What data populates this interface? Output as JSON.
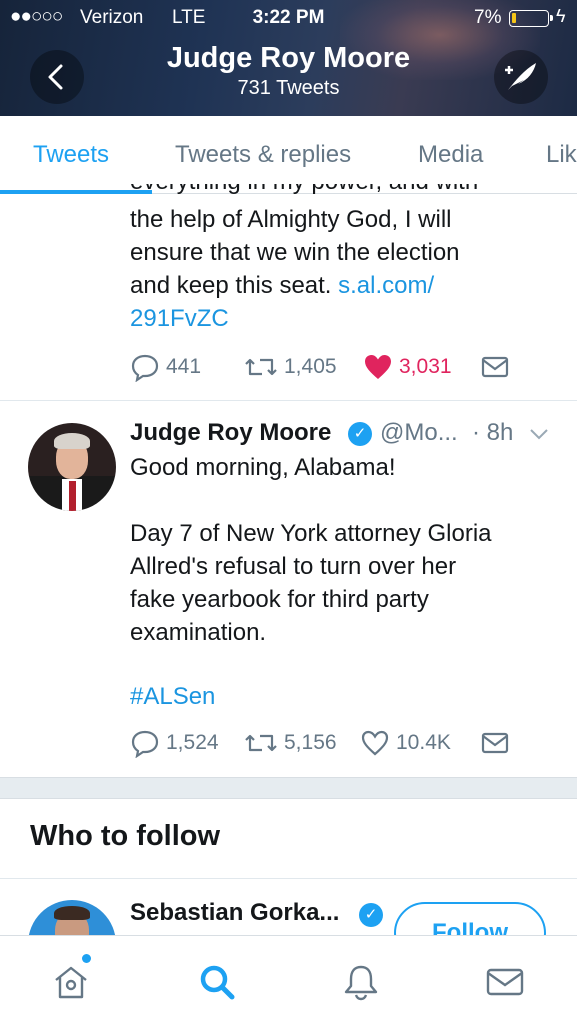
{
  "status_bar": {
    "signal": "●●○○○",
    "carrier": "Verizon",
    "network": "LTE",
    "time": "3:22 PM",
    "battery_pct": "7%",
    "battery_level": 0.07,
    "battery_color": "#f5c518"
  },
  "header": {
    "back_icon": "chevron-left-icon",
    "title": "Judge Roy Moore",
    "subtitle": "731 Tweets",
    "compose_icon": "compose-feather-icon"
  },
  "tabs": [
    {
      "label": "Tweets",
      "active": true
    },
    {
      "label": "Tweets & replies",
      "active": false
    },
    {
      "label": "Media",
      "active": false
    },
    {
      "label": "Lik",
      "active": false
    }
  ],
  "tweets": [
    {
      "clipped_line": "everything in my power, and with",
      "lines": [
        "the help of Almighty God, I will",
        "ensure that we win the election"
      ],
      "last_line_text": "and keep this seat.",
      "link_part1": "s.al.com/",
      "link_part2": "291FvZC",
      "replies": "441",
      "retweets": "1,405",
      "likes": "3,031",
      "liked": true
    },
    {
      "name": "Judge Roy Moore",
      "handle": "@Mo...",
      "time": "· 8h",
      "verified": true,
      "line1": "Good morning, Alabama!",
      "para_lines": [
        "Day 7 of New York attorney Gloria",
        "Allred's refusal to turn over her",
        "fake yearbook for third party",
        "examination."
      ],
      "hashtag": "#ALSen",
      "replies": "1,524",
      "retweets": "5,156",
      "likes": "10.4K",
      "liked": false
    }
  ],
  "who_to_follow": {
    "title": "Who to follow",
    "suggestion": {
      "name": "Sebastian Gorka...",
      "verified": true,
      "button": "Follow"
    }
  },
  "bottom_nav": [
    {
      "icon": "home-icon",
      "active": false,
      "has_notification": true
    },
    {
      "icon": "search-icon",
      "active": true
    },
    {
      "icon": "bell-icon",
      "active": false
    },
    {
      "icon": "mail-icon",
      "active": false
    }
  ],
  "colors": {
    "accent": "#1da1f2",
    "like": "#e0245e",
    "secondary_text": "#657786"
  }
}
